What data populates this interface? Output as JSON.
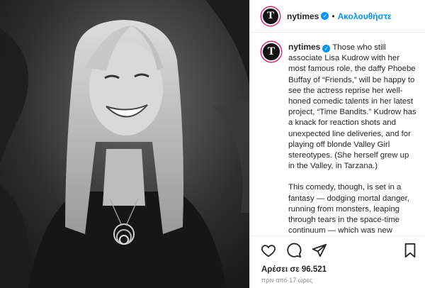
{
  "post": {
    "image_alt": "Black and white photo of a smiling woman with long straight hair",
    "account": "nytimes",
    "follow_label": "Ακολουθήστε",
    "avatar_letter": "T",
    "caption_p1": "Those who still associate Lisa Kudrow with her most famous role, the daffy Phoebe Buffay of “Friends,” will be happy to see the actress reprise her well-honed comedic talents in her latest project, “Time Bandits.” Kudrow has a knack for reaction shots and unexpected line deliveries, and for playing off blonde Valley Girl stereotypes. (She herself grew up in the Valley, in Tarzana.)",
    "caption_p2": "This comedy, though, is set in a fantasy — dodging mortal danger, running from monsters, leaping through tears in the space-time continuum — which was new territory for Kudrow. It was also a welcome change. The anxiety from the pandemic was then still lingering, and every new show she watched seemed",
    "likes_text": "Αρέσει σε 96.521",
    "time_text": "πριν από 17 ώρες"
  },
  "icons": [
    "heart-icon",
    "comment-icon",
    "share-icon",
    "bookmark-icon",
    "verified-icon"
  ],
  "colors": {
    "link": "#0095f6",
    "text": "#262626",
    "muted": "#8e8e8e"
  }
}
